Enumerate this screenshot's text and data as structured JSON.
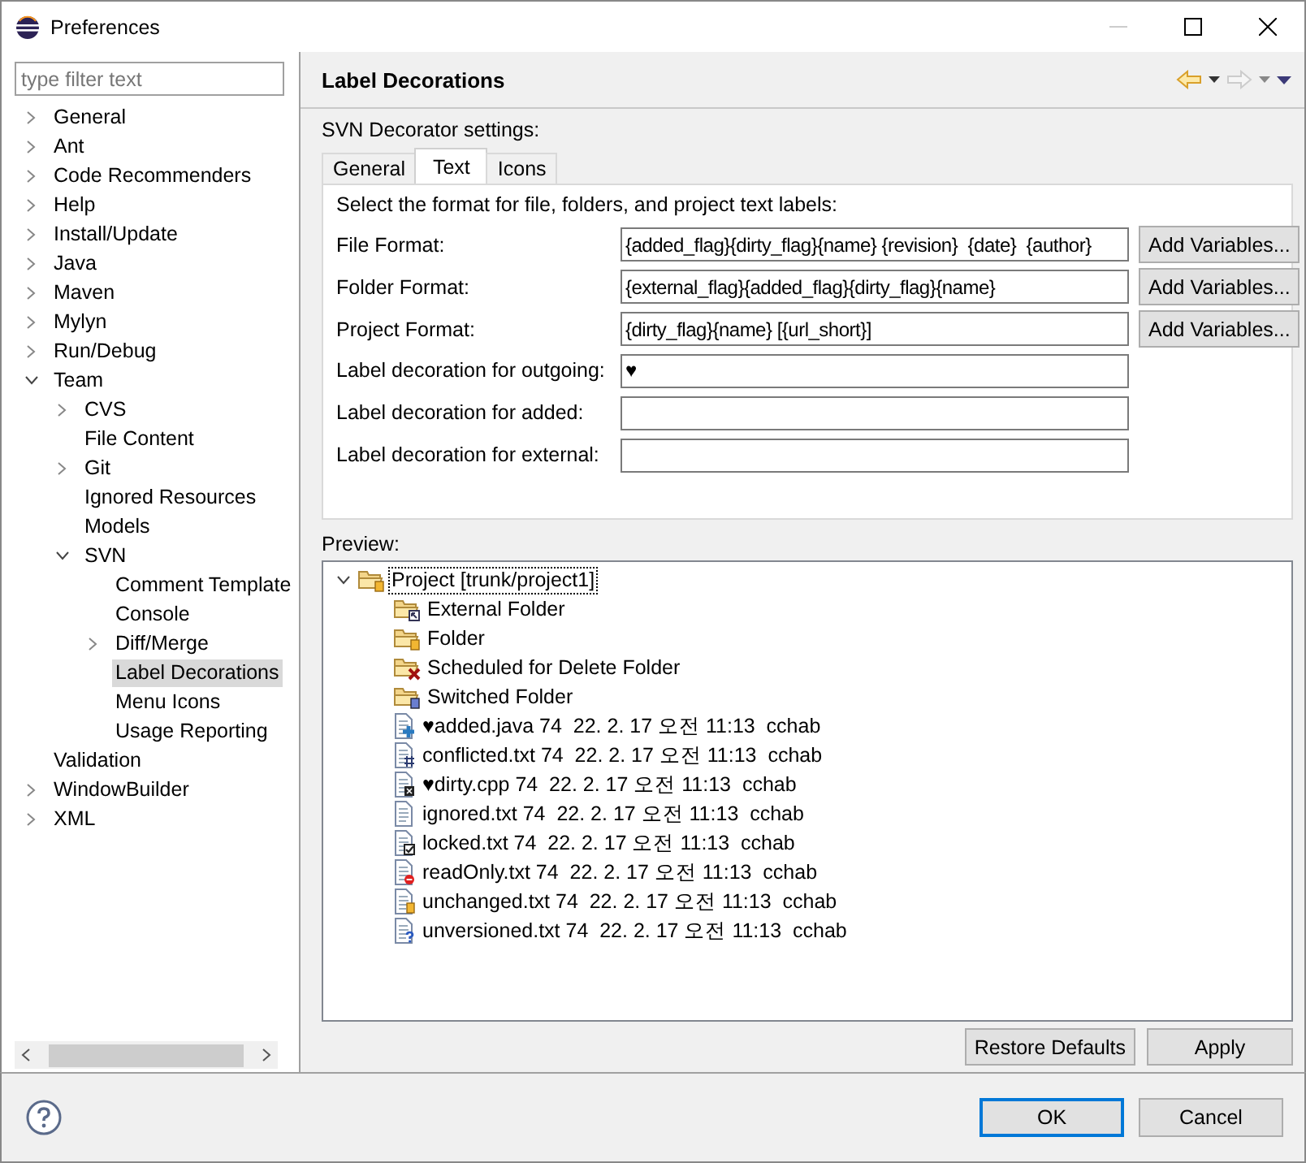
{
  "window": {
    "title": "Preferences"
  },
  "filter": {
    "placeholder": "type filter text"
  },
  "nav_tree": [
    {
      "label": "General",
      "kind": "branch",
      "expanded": false,
      "selected": false
    },
    {
      "label": "Ant",
      "kind": "branch",
      "expanded": false,
      "selected": false
    },
    {
      "label": "Code Recommenders",
      "kind": "branch",
      "expanded": false,
      "selected": false
    },
    {
      "label": "Help",
      "kind": "branch",
      "expanded": false,
      "selected": false
    },
    {
      "label": "Install/Update",
      "kind": "branch",
      "expanded": false,
      "selected": false
    },
    {
      "label": "Java",
      "kind": "branch",
      "expanded": false,
      "selected": false
    },
    {
      "label": "Maven",
      "kind": "branch",
      "expanded": false,
      "selected": false
    },
    {
      "label": "Mylyn",
      "kind": "branch",
      "expanded": false,
      "selected": false
    },
    {
      "label": "Run/Debug",
      "kind": "branch",
      "expanded": false,
      "selected": false
    },
    {
      "label": "Team",
      "kind": "branch",
      "expanded": true,
      "selected": false,
      "children": [
        {
          "label": "CVS",
          "kind": "branch",
          "expanded": false,
          "selected": false
        },
        {
          "label": "File Content",
          "kind": "leaf",
          "selected": false
        },
        {
          "label": "Git",
          "kind": "branch",
          "expanded": false,
          "selected": false
        },
        {
          "label": "Ignored Resources",
          "kind": "leaf",
          "selected": false
        },
        {
          "label": "Models",
          "kind": "leaf",
          "selected": false
        },
        {
          "label": "SVN",
          "kind": "branch",
          "expanded": true,
          "selected": false,
          "children": [
            {
              "label": "Comment Template",
              "kind": "leaf",
              "selected": false
            },
            {
              "label": "Console",
              "kind": "leaf",
              "selected": false
            },
            {
              "label": "Diff/Merge",
              "kind": "branch",
              "expanded": false,
              "selected": false
            },
            {
              "label": "Label Decorations",
              "kind": "leaf",
              "selected": true
            },
            {
              "label": "Menu Icons",
              "kind": "leaf",
              "selected": false
            },
            {
              "label": "Usage Reporting",
              "kind": "leaf",
              "selected": false
            }
          ]
        }
      ]
    },
    {
      "label": "Validation",
      "kind": "leaf",
      "selected": false
    },
    {
      "label": "WindowBuilder",
      "kind": "branch",
      "expanded": false,
      "selected": false
    },
    {
      "label": "XML",
      "kind": "branch",
      "expanded": false,
      "selected": false
    }
  ],
  "page": {
    "title": "Label Decorations",
    "group_label": "SVN Decorator settings:",
    "tabs": [
      {
        "label": "General",
        "selected": false
      },
      {
        "label": "Text",
        "selected": true
      },
      {
        "label": "Icons",
        "selected": false
      }
    ],
    "intro": "Select the format for file, folders, and project text labels:",
    "fields": [
      {
        "label": "File Format:",
        "value": "{added_flag}{dirty_flag}{name} {revision}  {date}  {author}",
        "button": "Add Variables..."
      },
      {
        "label": "Folder Format:",
        "value": "{external_flag}{added_flag}{dirty_flag}{name}",
        "button": "Add Variables..."
      },
      {
        "label": "Project Format:",
        "value": "{dirty_flag}{name} [{url_short}]",
        "button": "Add Variables..."
      },
      {
        "label": "Label decoration for outgoing:",
        "value": "♥"
      },
      {
        "label": "Label decoration for added:"
      },
      {
        "label": "Label decoration for external:"
      }
    ],
    "preview_label": "Preview:",
    "preview": [
      {
        "label": "Project [trunk/project1]",
        "kind": "project",
        "expanded": true,
        "children": [
          {
            "label": "External Folder",
            "kind": "external-folder"
          },
          {
            "label": "Folder",
            "kind": "folder"
          },
          {
            "label": "Scheduled for Delete Folder",
            "kind": "deleted-folder"
          },
          {
            "label": "Switched Folder",
            "kind": "switched-folder"
          },
          {
            "label": "♥added.java 74  22. 2. 17 오전 11:13  cchab",
            "kind": "added-file"
          },
          {
            "label": "conflicted.txt 74  22. 2. 17 오전 11:13  cchab",
            "kind": "conflicted-file"
          },
          {
            "label": "♥dirty.cpp 74  22. 2. 17 오전 11:13  cchab",
            "kind": "dirty-file"
          },
          {
            "label": "ignored.txt 74  22. 2. 17 오전 11:13  cchab",
            "kind": "ignored-file"
          },
          {
            "label": "locked.txt 74  22. 2. 17 오전 11:13  cchab",
            "kind": "locked-file"
          },
          {
            "label": "readOnly.txt 74  22. 2. 17 오전 11:13  cchab",
            "kind": "readonly-file"
          },
          {
            "label": "unchanged.txt 74  22. 2. 17 오전 11:13  cchab",
            "kind": "unchanged-file"
          },
          {
            "label": "unversioned.txt 74  22. 2. 17 오전 11:13  cchab",
            "kind": "unversioned-file"
          }
        ]
      }
    ],
    "page_buttons": [
      "Restore Defaults",
      "Apply"
    ]
  },
  "dialog_buttons": [
    {
      "label": "OK",
      "default": true
    },
    {
      "label": "Cancel",
      "default": false
    }
  ]
}
